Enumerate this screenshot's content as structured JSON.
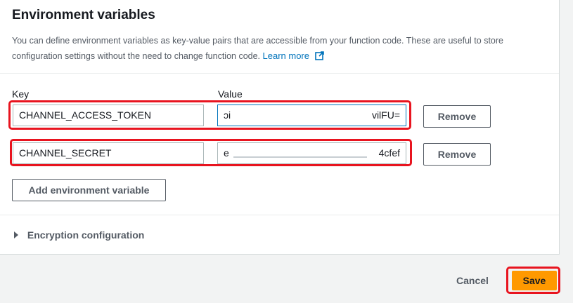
{
  "section": {
    "title": "Environment variables",
    "description": "You can define environment variables as key-value pairs that are accessible from your function code. These are useful to store configuration settings without the need to change function code.",
    "learn_more": "Learn more"
  },
  "columns": {
    "key": "Key",
    "value": "Value"
  },
  "variables": [
    {
      "key": "CHANNEL_ACCESS_TOKEN",
      "value_start": "ɔi",
      "value_end": "vilFU=",
      "remove_label": "Remove"
    },
    {
      "key": "CHANNEL_SECRET",
      "value_start": "e",
      "value_end": "4cfef",
      "remove_label": "Remove"
    }
  ],
  "add_button": "Add environment variable",
  "encryption": {
    "label": "Encryption configuration"
  },
  "footer": {
    "cancel": "Cancel",
    "save": "Save"
  },
  "colors": {
    "highlight": "#e8141f",
    "primary": "#ff9900",
    "link": "#0073bb"
  },
  "icons": {
    "external_link": "external-link-icon",
    "caret": "caret-right-icon"
  }
}
